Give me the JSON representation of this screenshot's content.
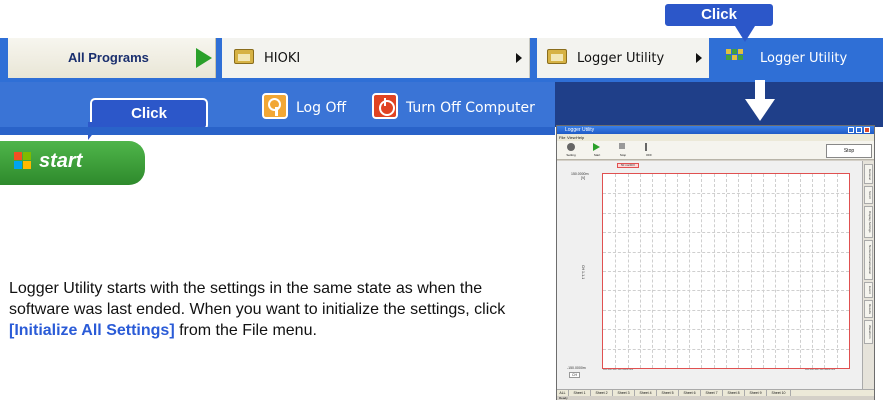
{
  "start_menu": {
    "all_programs_label": "All Programs",
    "hioki_label": "HIOKI",
    "logger_folder_label": "Logger Utility",
    "logger_app_label": "Logger Utility",
    "log_off_label": "Log Off",
    "turn_off_label": "Turn Off Computer",
    "start_label": "start"
  },
  "callouts": {
    "top_click": "Click",
    "start_click": "Click"
  },
  "description": {
    "text_before": "Logger Utility starts with the settings in the same state as when the software was last ended. When you want to initialize the settings, click ",
    "highlight": "[Initialize All Settings]",
    "text_after": " from the File menu."
  },
  "app_window": {
    "title": "Logger Utility",
    "menu": [
      "File",
      "View",
      "Help"
    ],
    "toolbar": [
      {
        "label": "Setting",
        "icon": "gear-icon"
      },
      {
        "label": "Start",
        "icon": "play-icon"
      },
      {
        "label": "Stop",
        "icon": "stop-icon"
      },
      {
        "label": "OFF",
        "icon": "cursor-icon"
      }
    ],
    "stop_status": "Stop",
    "time_div": "50 ms/DIV",
    "y_top": "150.0000m",
    "y_top_unit": "[V]",
    "y_bottom": "-150.0000m",
    "ch_label": "CH 1-1-1",
    "ch_button": "CH",
    "x_start": "00:00:00 00.000.00",
    "x_end": "00:00:00 00.500.00",
    "side_tabs": [
      "General",
      "Scroll",
      "Display Settings",
      "Numerical Calculation",
      "Event",
      "Results",
      "Waveform"
    ],
    "sheet_tabs": [
      "ALL",
      "Sheet 1",
      "Sheet 2",
      "Sheet 3",
      "Sheet 4",
      "Sheet 5",
      "Sheet 6",
      "Sheet 7",
      "Sheet 8",
      "Sheet 9",
      "Sheet 10"
    ],
    "status": "Ready"
  },
  "colors": {
    "xp_blue": "#2f6fd6",
    "callout_blue": "#2c57c9",
    "start_green": "#3ea53a",
    "highlight_blue": "#2a5bd7"
  }
}
